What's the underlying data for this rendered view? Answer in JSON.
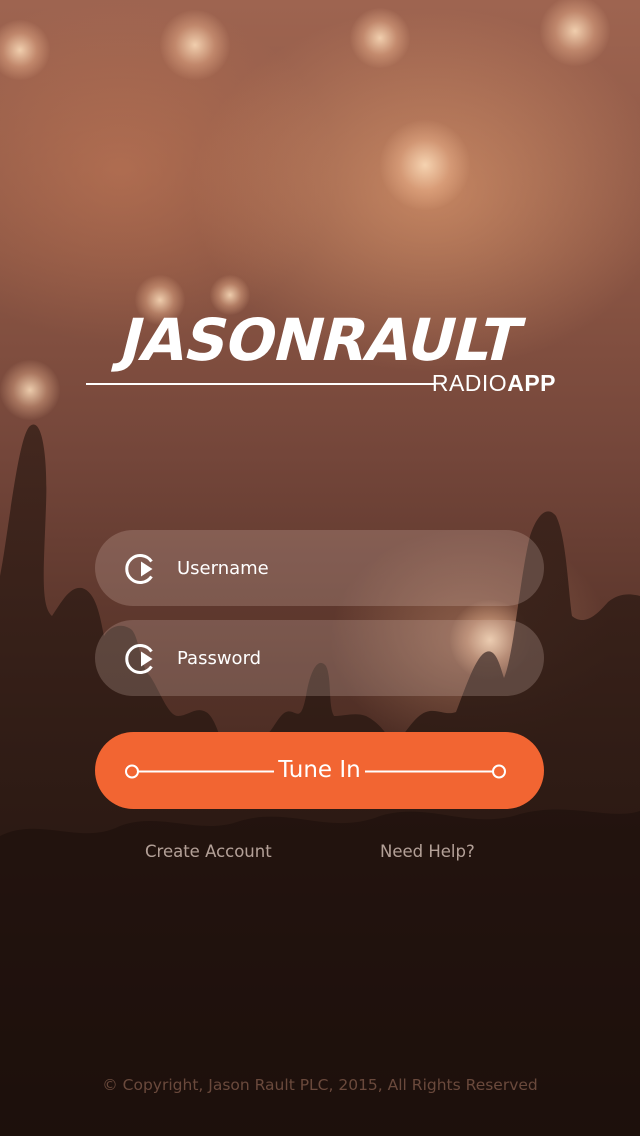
{
  "brand": {
    "name": "JASONRAULT",
    "sub_light": "RADIO",
    "sub_bold": "APP"
  },
  "login": {
    "username": {
      "placeholder": "Username",
      "icon": "play-circle-icon"
    },
    "password": {
      "placeholder": "Password",
      "icon": "play-circle-icon"
    },
    "submit_label": "Tune In"
  },
  "links": {
    "create_account": "Create Account",
    "need_help": "Need Help?"
  },
  "footer": {
    "copyright": "© Copyright, Jason Rault PLC,  2015, All Rights Reserved"
  },
  "colors": {
    "accent": "#f26532",
    "text": "#ffffff"
  }
}
